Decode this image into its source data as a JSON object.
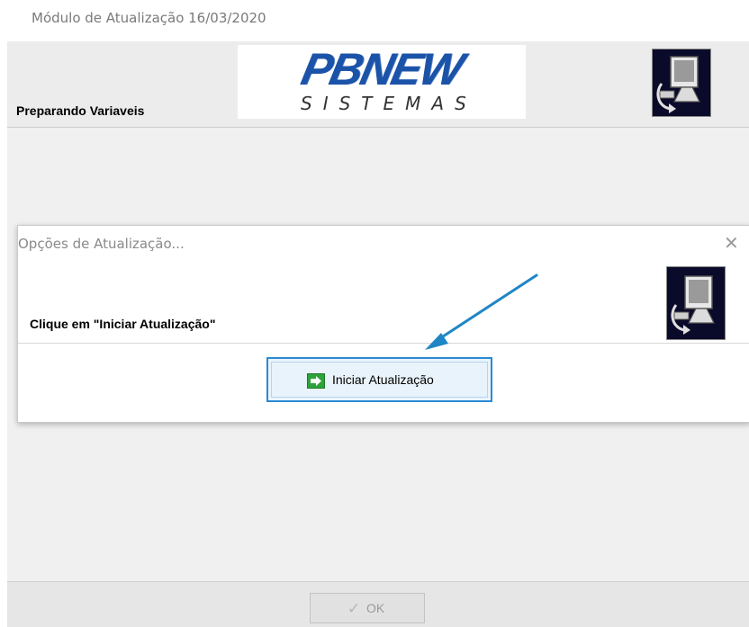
{
  "window": {
    "title": "Módulo de Atualização 16/03/2020"
  },
  "header": {
    "status_text": "Preparando Variaveis",
    "logo_brand": "PBNEW",
    "logo_sub": "SISTEMAS",
    "icon": "computer-update-icon"
  },
  "dialog": {
    "title": "Opções de Atualização...",
    "close_glyph": "✕",
    "message": "Clique em \"Iniciar Atualização\"",
    "icon": "computer-update-icon",
    "start_button": {
      "label": "Iniciar Atualização",
      "icon": "green-arrow-icon"
    }
  },
  "footer": {
    "ok_label": "OK",
    "ok_icon": "checkmark-icon",
    "ok_enabled": false
  },
  "colors": {
    "accent": "#2a8ad4",
    "annotation_arrow": "#1f86c6",
    "logo_blue": "#1b53a8",
    "icon_green": "#2ea33b"
  }
}
